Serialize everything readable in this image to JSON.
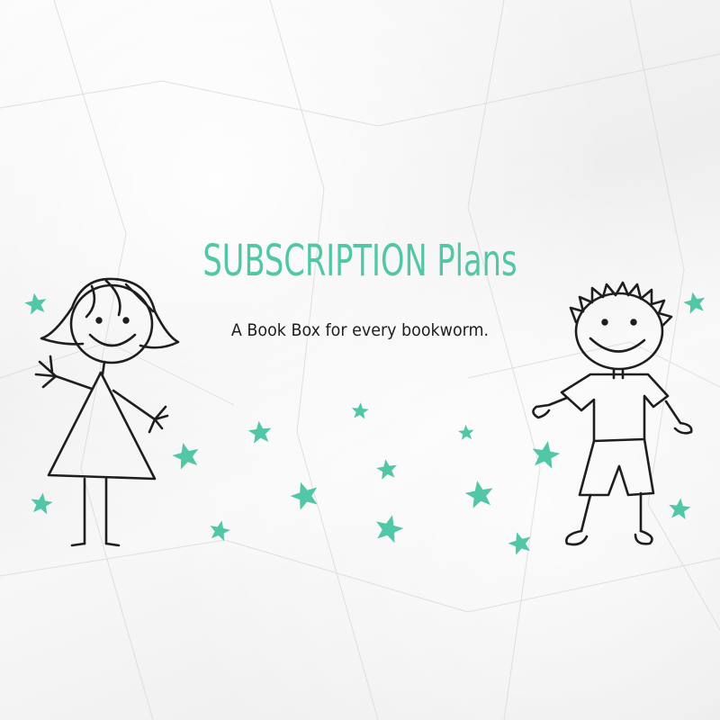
{
  "banner": {
    "title": "SUBSCRIPTION Plans",
    "subtitle": "A Book Box for every bookworm."
  },
  "colors": {
    "accent": "#52c7a7",
    "ink": "#1e1e1e",
    "paper": "#f4f4f4"
  },
  "illustrations": {
    "girl": "stick-figure-girl",
    "boy": "stick-figure-boy",
    "stars": "star-icon"
  }
}
